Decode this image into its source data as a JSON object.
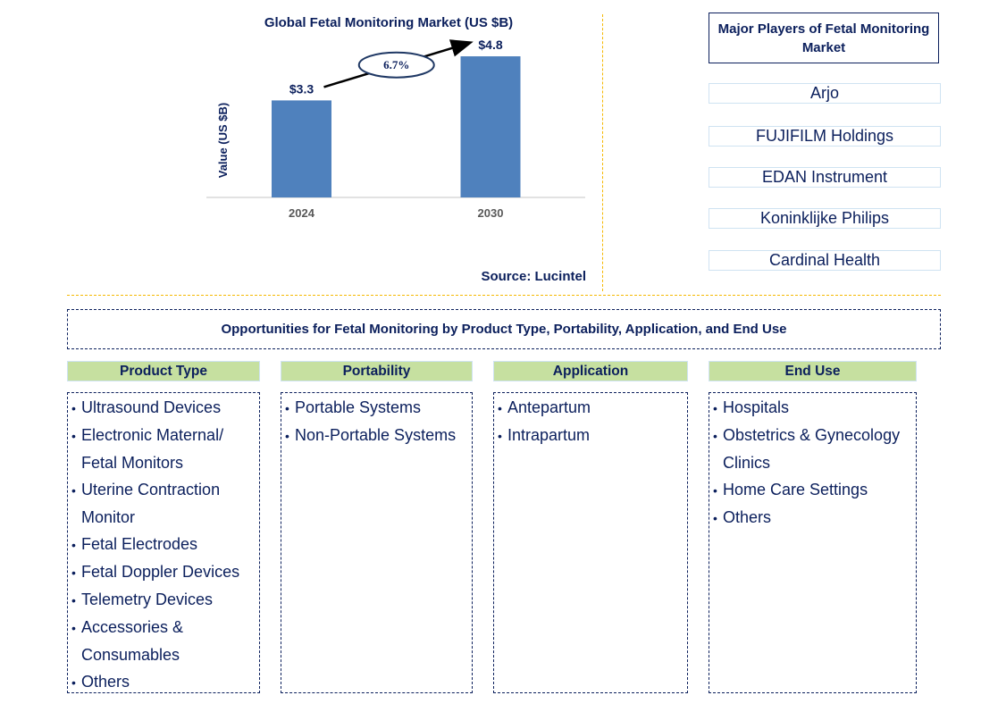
{
  "chart_data": {
    "type": "bar",
    "title": "Global Fetal Monitoring Market (US $B)",
    "xlabel": "",
    "ylabel": "Value (US $B)",
    "categories": [
      "2024",
      "2030"
    ],
    "values": [
      3.3,
      4.8
    ],
    "data_labels": [
      "$3.3",
      "$4.8"
    ],
    "ylim": [
      0,
      5.5
    ],
    "grid": false,
    "bar_color": "#4f81bd",
    "annotation": {
      "type": "cagr-arrow",
      "label": "6.7%",
      "from": "2024",
      "to": "2030"
    },
    "source": "Source: Lucintel"
  },
  "players": {
    "title": "Major Players of Fetal Monitoring Market",
    "items": [
      "Arjo",
      "FUJIFILM Holdings",
      "EDAN Instrument",
      "Koninklijke Philips",
      "Cardinal Health"
    ]
  },
  "opportunities": {
    "title": "Opportunities for Fetal Monitoring by Product Type, Portability, Application, and End Use",
    "categories": [
      {
        "label": "Product Type",
        "items": [
          "Ultrasound Devices",
          "Electronic Maternal/ Fetal Monitors",
          "Uterine Contraction Monitor",
          "Fetal Electrodes",
          "Fetal Doppler Devices",
          "Telemetry Devices",
          "Accessories & Consumables",
          "Others"
        ]
      },
      {
        "label": "Portability",
        "items": [
          "Portable Systems",
          "Non-Portable Systems"
        ]
      },
      {
        "label": "Application",
        "items": [
          "Antepartum",
          "Intrapartum"
        ]
      },
      {
        "label": "End Use",
        "items": [
          "Hospitals",
          "Obstetrics & Gynecology Clinics",
          "Home Care Settings",
          "Others"
        ]
      }
    ]
  },
  "colors": {
    "text": "#0b1f5c",
    "bar": "#4f81bd",
    "divider": "#f5b800",
    "category_header_bg": "#c6e0a0"
  }
}
